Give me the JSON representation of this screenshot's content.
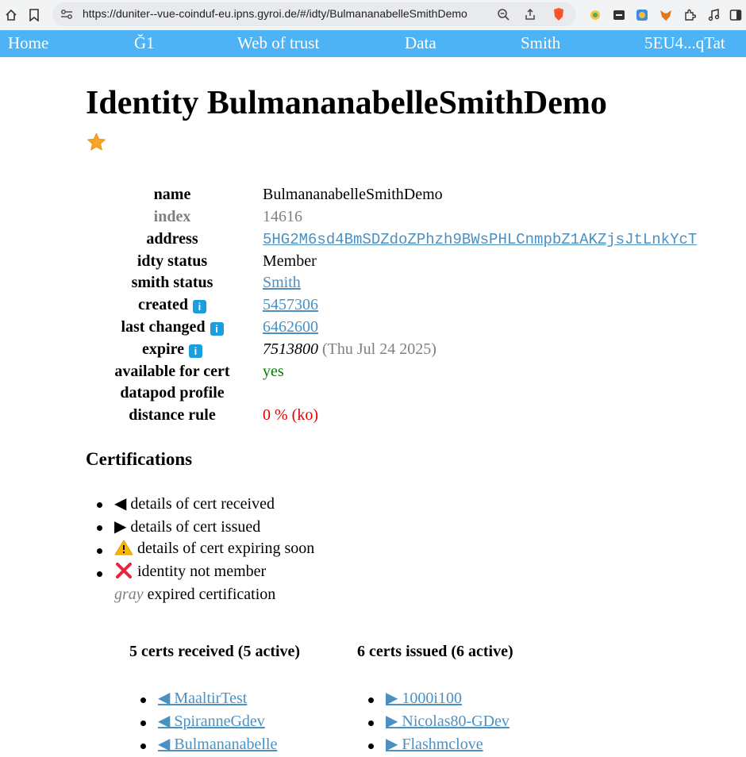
{
  "browser": {
    "url": "https://duniter--vue-coinduf-eu.ipns.gyroi.de/#/idty/BulmananabelleSmithDemo"
  },
  "nav": {
    "items": [
      "Home",
      "Ğ1",
      "Web of trust",
      "Data",
      "Smith",
      "5EU4...qTat"
    ]
  },
  "page": {
    "title": "Identity BulmananabelleSmithDemo"
  },
  "identity": {
    "labels": {
      "name": "name",
      "index": "index",
      "address": "address",
      "idty_status": "idty status",
      "smith_status": "smith status",
      "created": "created",
      "last_changed": "last changed",
      "expire": "expire",
      "available_for_cert": "available for cert",
      "datapod_profile": "datapod profile",
      "distance_rule": "distance rule"
    },
    "values": {
      "name": "BulmananabelleSmithDemo",
      "index": "14616",
      "address": "5HG2M6sd4BmSDZdoZPhzh9BWsPHLCnmpbZ1AKZjsJtLnkYcT",
      "idty_status": "Member",
      "smith_status": "Smith",
      "created": "5457306",
      "last_changed": "6462600",
      "expire_block": "7513800",
      "expire_date": "(Thu Jul 24 2025)",
      "available_for_cert": "yes",
      "distance_rule": "0 % (ko)"
    },
    "colors": {
      "accent_link": "#4a90c2",
      "ok": "#008000",
      "ko": "#e00000",
      "muted": "#808080"
    }
  },
  "certifications": {
    "heading": "Certifications",
    "legend": {
      "received": "details of cert received",
      "issued": "details of cert issued",
      "expiring": "details of cert expiring soon",
      "not_member": "identity not member",
      "gray_word": "gray",
      "expired": "expired certification"
    },
    "received": {
      "header": "5 certs received (5 active)",
      "items": [
        "◀ MaaltirTest",
        "◀ SpiranneGdev",
        "◀ Bulmananabelle"
      ]
    },
    "issued": {
      "header": "6 certs issued (6 active)",
      "items": [
        "▶ 1000i100",
        "▶ Nicolas80-GDev",
        "▶ Flashmclove"
      ]
    }
  }
}
